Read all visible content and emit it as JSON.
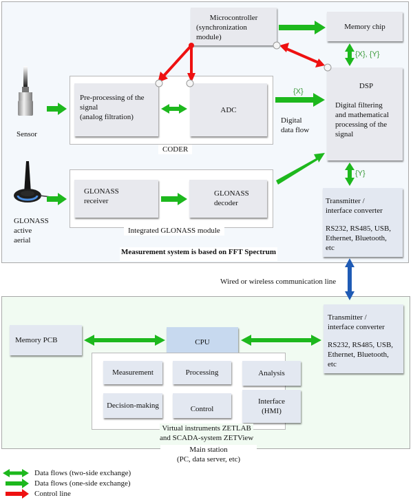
{
  "colors": {
    "data_flow": "#1db81d",
    "control_line": "#ee1111",
    "comm_line": "#1f5bb5",
    "top_panel_bg": "#f4f8fc",
    "bottom_panel_bg": "#f1fbf2"
  },
  "measurement_system": {
    "title": "Measurement system is based on FFT Spectrum",
    "sensor": {
      "icon": "sensor-icon",
      "label": "Sensor"
    },
    "aerial": {
      "icon": "antenna-icon",
      "label_lines": [
        "GLONASS",
        "active",
        "aerial"
      ]
    },
    "coder": {
      "label": "CODER",
      "preprocessing_lines": [
        "Pre-processing of the",
        "signal",
        "(analog filtration)"
      ],
      "adc": "ADC"
    },
    "glonass_module": {
      "label": "Integrated GLONASS module",
      "receiver_lines": [
        "GLONASS",
        "receiver"
      ],
      "decoder_lines": [
        "GLONASS",
        "decoder"
      ]
    },
    "microcontroller_lines": [
      "Microcontroller",
      "(synchronization",
      "module)"
    ],
    "memory_chip": "Memory chip",
    "dsp": {
      "title": "DSP",
      "desc_lines": [
        "Digital filtering",
        "and mathematical",
        "processing of the",
        "signal"
      ]
    },
    "transmitter": {
      "lines": [
        "Transmitter /",
        "interface converter"
      ],
      "protocol_lines": [
        "RS232, RS485, USB,",
        "Ethernet, Bluetooth,",
        "etc"
      ]
    },
    "labels": {
      "x": "{X}",
      "xy": "{X}, {Y}",
      "y": "{Y}",
      "digital_flow_lines": [
        "Digital",
        "data flow"
      ]
    }
  },
  "communication_line": "Wired or wireless communication line",
  "main_station": {
    "label_lines": [
      "Main station",
      "(PC, data server, etc)"
    ],
    "memory_pcb": "Memory PCB",
    "cpu": "CPU",
    "transmitter": {
      "lines": [
        "Transmitter /",
        "interface converter"
      ],
      "protocol_lines": [
        "RS232, RS485, USB,",
        "Ethernet, Bluetooth,",
        "etc"
      ]
    },
    "virtual_instruments": {
      "label_lines": [
        "Virtual instruments ZETLAB",
        "and SCADA-system ZETView"
      ],
      "modules": [
        "Measurement",
        "Processing",
        "Analysis",
        "Decision-making",
        "Control"
      ],
      "interface_lines": [
        "Interface",
        "(HMI)"
      ]
    }
  },
  "legend": [
    {
      "icon": "two-way-arrow-icon",
      "label": "Data flows (two-side exchange)"
    },
    {
      "icon": "one-way-arrow-icon",
      "label": "Data flows (one-side exchange)"
    },
    {
      "icon": "control-arrow-icon",
      "label": "Control line"
    }
  ]
}
